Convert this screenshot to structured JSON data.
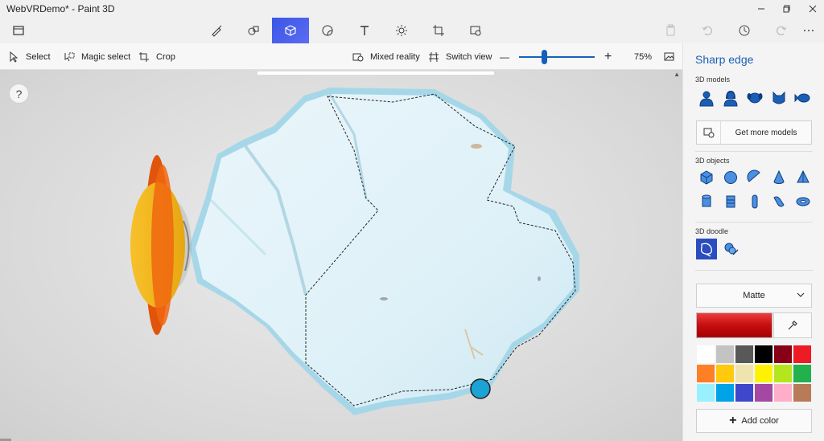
{
  "window": {
    "title": "WebVRDemo* - Paint 3D",
    "controls": [
      "minimize-icon",
      "maximize-icon",
      "close-icon"
    ]
  },
  "main_toolbar": {
    "tabs": [
      {
        "name": "brushes",
        "icon": "brush-icon"
      },
      {
        "name": "2d-shapes",
        "icon": "2d-shapes-icon"
      },
      {
        "name": "3d-shapes",
        "icon": "3d-cube-icon",
        "active": true
      },
      {
        "name": "stickers",
        "icon": "sticker-icon"
      },
      {
        "name": "text",
        "icon": "text-icon"
      },
      {
        "name": "effects",
        "icon": "effects-icon"
      },
      {
        "name": "canvas",
        "icon": "canvas-icon"
      },
      {
        "name": "remix3d",
        "icon": "remix3d-icon"
      }
    ],
    "right_tools": [
      "paste-icon",
      "undo-icon",
      "history-icon",
      "redo-icon",
      "more-icon"
    ]
  },
  "sub_toolbar": {
    "select": "Select",
    "magic_select": "Magic select",
    "crop": "Crop",
    "mixed_reality": "Mixed reality",
    "switch_view": "Switch view",
    "zoom_out": "—",
    "zoom_in": "+",
    "zoom_level": "75%",
    "zoom_fraction": 0.33
  },
  "canvas": {
    "help": "?"
  },
  "panel": {
    "title": "Sharp edge",
    "models_label": "3D models",
    "models": [
      "man-model-icon",
      "woman-model-icon",
      "dog-model-icon",
      "cat-model-icon",
      "fish-model-icon"
    ],
    "get_more": "Get more models",
    "objects_label": "3D objects",
    "objects": [
      "cube-icon",
      "sphere-icon",
      "hemisphere-icon",
      "cone-icon",
      "pyramid-icon",
      "cylinder-icon",
      "tube-icon",
      "capsule-icon",
      "cone-rounded-icon",
      "torus-icon"
    ],
    "doodle_label": "3D doodle",
    "doodles": [
      {
        "icon": "sharp-edge-doodle-icon",
        "selected": true
      },
      {
        "icon": "soft-edge-doodle-icon",
        "selected": false
      }
    ],
    "material": "Matte",
    "selected_color": "#d21b1b",
    "swatches": [
      "#ffffff",
      "#c3c3c3",
      "#585858",
      "#000000",
      "#880015",
      "#ed1c24",
      "#ff7f27",
      "#ffc90e",
      "#efe4b0",
      "#fff200",
      "#b5e61d",
      "#22b14c",
      "#99f0ff",
      "#00a2e8",
      "#3f48cc",
      "#a349a4",
      "#ffaec9",
      "#b97a57"
    ],
    "add_color": "Add color"
  }
}
